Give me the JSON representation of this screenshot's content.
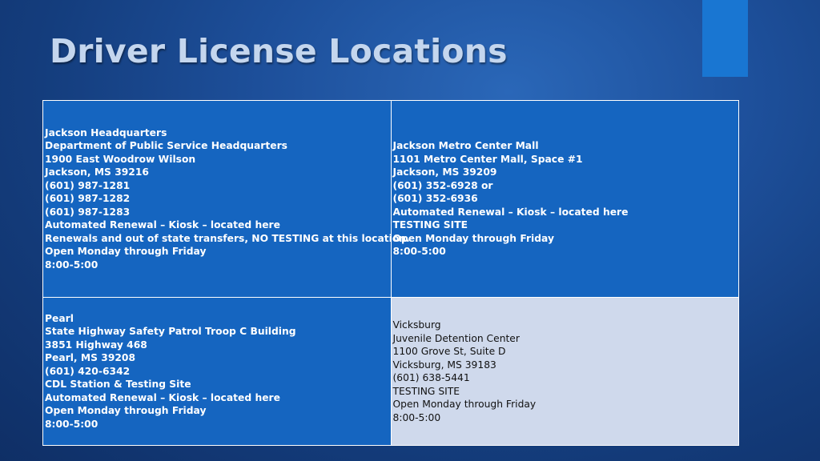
{
  "slide": {
    "title": "Driver License Locations"
  },
  "locations": [
    {
      "lines": [
        "Jackson Headquarters",
        "Department of Public Service Headquarters",
        "1900 East Woodrow Wilson",
        "Jackson, MS 39216",
        "(601) 987-1281",
        "(601) 987-1282",
        "(601) 987-1283",
        "Automated Renewal – Kiosk – located here",
        "Renewals and out of state transfers, NO TESTING at this location.",
        "Open Monday through Friday",
        "8:00-5:00"
      ]
    },
    {
      "lines": [
        "Jackson Metro Center Mall",
        "1101 Metro Center Mall, Space #1",
        "Jackson, MS 39209",
        "(601) 352-6928 or",
        "(601) 352-6936",
        "Automated Renewal – Kiosk – located here",
        "TESTING SITE",
        "Open Monday through Friday",
        "8:00-5:00"
      ]
    },
    {
      "lines": [
        "Pearl",
        "State Highway Safety Patrol Troop C Building",
        "3851 Highway 468",
        "Pearl, MS 39208",
        "(601) 420-6342",
        "CDL Station & Testing Site",
        "Automated Renewal – Kiosk – located here",
        "Open Monday through Friday",
        "8:00-5:00"
      ]
    },
    {
      "lines": [
        "Vicksburg",
        "Juvenile Detention Center",
        "1100 Grove St, Suite D",
        "Vicksburg, MS 39183",
        "(601) 638-5441",
        "TESTING SITE",
        "Open Monday through Friday",
        "8:00-5:00"
      ]
    }
  ],
  "colors": {
    "background": "#1a4a94",
    "accent_bar": "#1976d2",
    "cell_blue": "#1565c0",
    "cell_light": "#cfd9ec",
    "title": "#c4d6ee"
  }
}
